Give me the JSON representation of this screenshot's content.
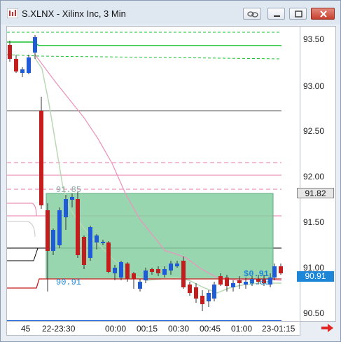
{
  "window": {
    "title": "S.XLNX - Xilinx Inc, 3 Min"
  },
  "chart": {
    "price_ticks": [
      "93.50",
      "93.00",
      "92.50",
      "92.00",
      "91.50",
      "91.00",
      "90.50"
    ],
    "time_ticks": [
      "45",
      "22-23:30",
      "00:00",
      "00:15",
      "00:30",
      "00:45",
      "01:00",
      "23-01:15"
    ],
    "price_labels": {
      "upper": "91.82",
      "last": "90.91"
    },
    "annotations": {
      "box_top": "91.85",
      "box_bottom": "90.91",
      "right_a": "$0.91",
      "right_b": "0.63"
    },
    "colors": {
      "bull": "#1f5bd8",
      "bear": "#c31d1d",
      "box_fill": "#86cfa2",
      "last_price": "#1e86d6",
      "upper_band": "#18c12f",
      "arrow": "#e22525"
    }
  }
}
